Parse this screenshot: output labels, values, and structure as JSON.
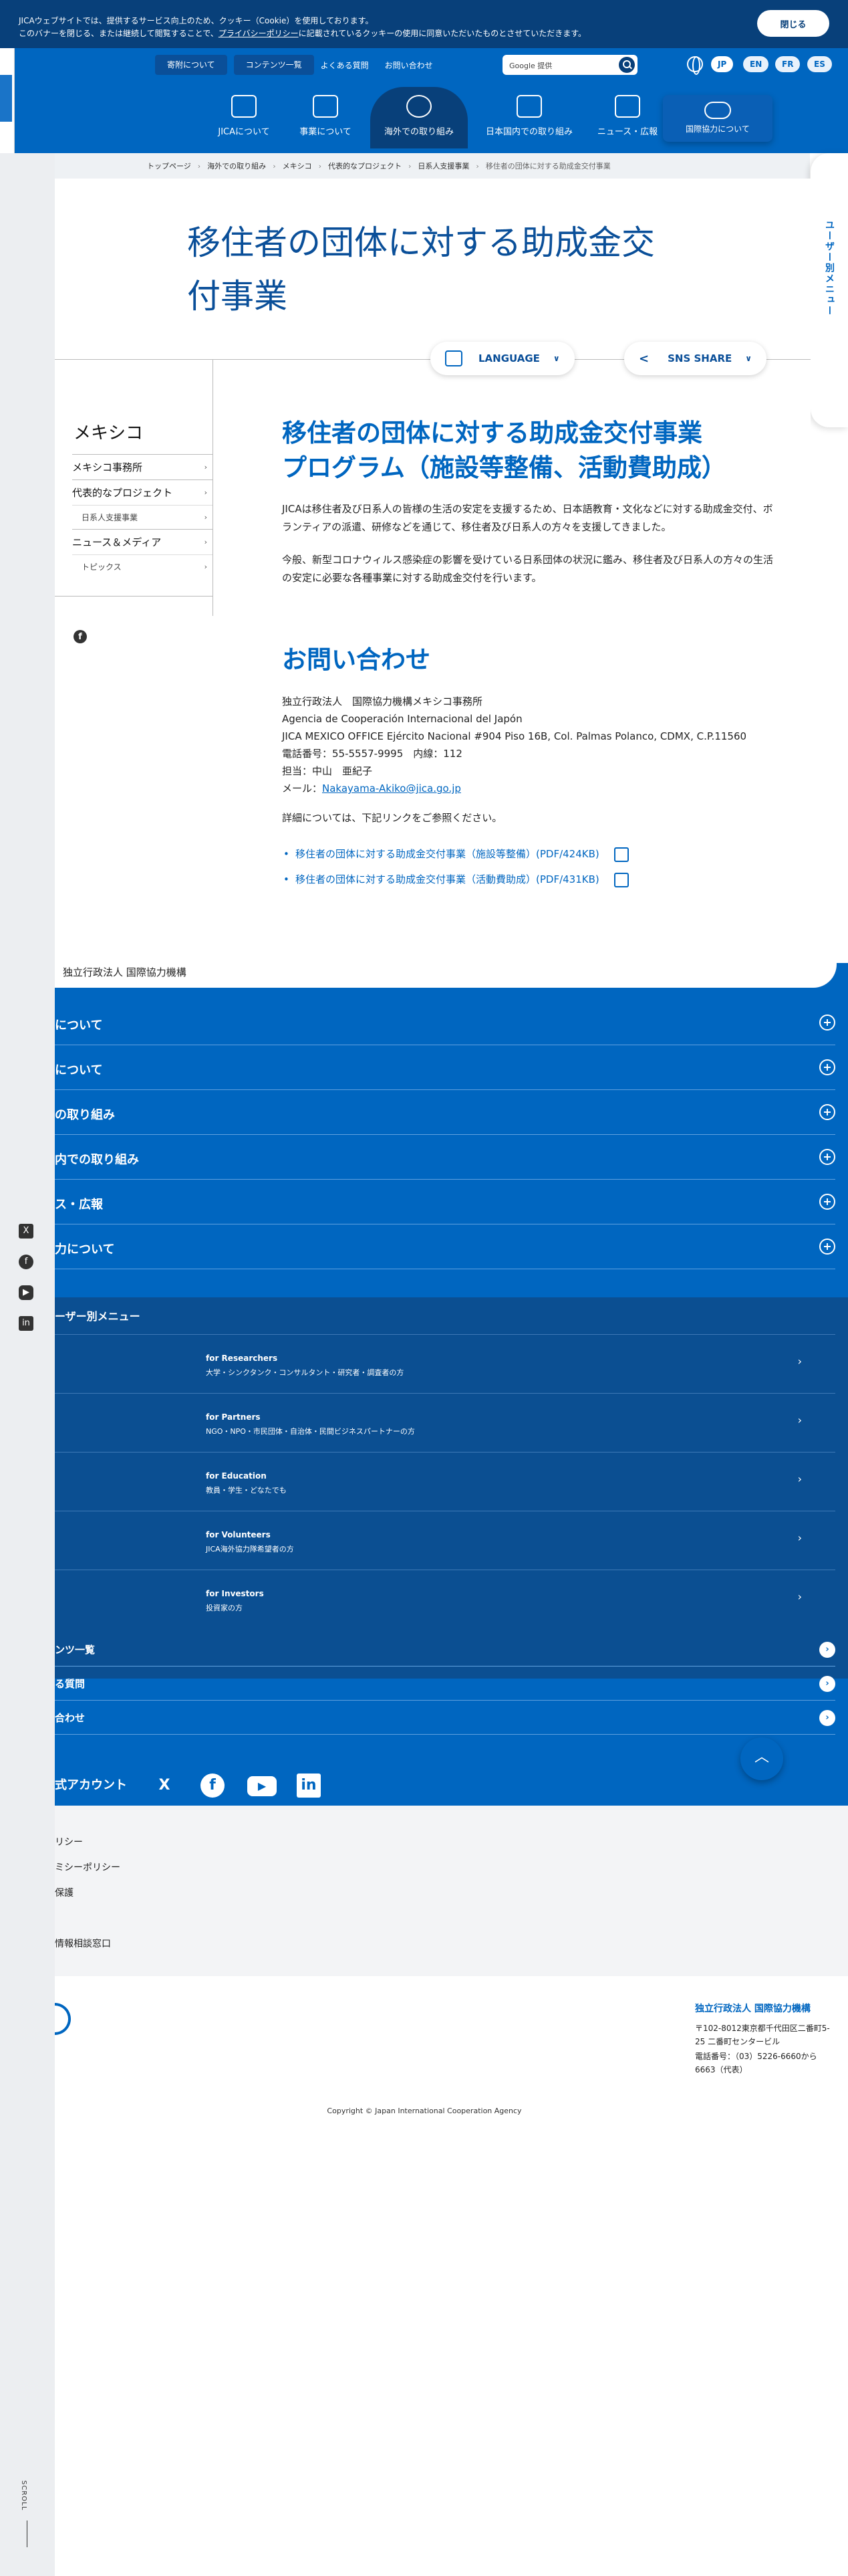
{
  "cookie": {
    "line1": "JICAウェブサイトでは、提供するサービス向上のため、クッキー（Cookie）を使用しております。",
    "line2_pre": "このバナーを閉じる、または継続して閲覧することで、",
    "line2_link": "プライバシーポリシー",
    "line2_post": "に記載されているクッキーの使用に同意いただいたものとさせていただきます。",
    "close_label": "閉じる"
  },
  "topnav": {
    "donate": "寄附について",
    "contents": "コンテンツ一覧",
    "faq": "よくある質問",
    "contact": "お問い合わせ",
    "search_placeholder": "Google 提供",
    "langs": [
      "JP",
      "EN",
      "FR",
      "ES"
    ]
  },
  "mainnav": {
    "items": [
      "JICAについて",
      "事業について",
      "海外での取り組み",
      "日本国内での取り組み",
      "ニュース・広報"
    ],
    "about": "国際協力について"
  },
  "breadcrumb": [
    "トップページ",
    "海外での取り組み",
    "メキシコ",
    "代表的なプロジェクト",
    "日系人支援事業",
    "移住者の団体に対する助成金交付事業"
  ],
  "usermenu": {
    "label": "ユーザー別メニュー"
  },
  "page": {
    "title_line1": "移住者の団体に対する助成金交",
    "title_line2": "付事業",
    "language_btn": "LANGUAGE",
    "sns_btn": "SNS SHARE"
  },
  "sidebar": {
    "heading": "メキシコ",
    "items": [
      {
        "label": "メキシコ事務所",
        "sub": false
      },
      {
        "label": "代表的なプロジェクト",
        "sub": false
      },
      {
        "label": "日系人支援事業",
        "sub": true
      },
      {
        "label": "ニュース＆メディア",
        "sub": false
      },
      {
        "label": "トピックス",
        "sub": true
      }
    ]
  },
  "content": {
    "heading_line1": "移住者の団体に対する助成金交付事業",
    "heading_line2": "プログラム（施設等整備、活動費助成）",
    "para1": "JICAは移住者及び日系人の皆様の生活の安定を支援するため、日本語教育・文化などに対する助成金交付、ボランティアの派遣、研修などを通じて、移住者及び日系人の方々を支援してきました。",
    "para2": "今般、新型コロナウィルス感染症の影響を受けている日系団体の状況に鑑み、移住者及び日系人の方々の生活の安定に必要な各種事業に対する助成金交付を行います。",
    "contact_heading": "お問い合わせ",
    "contact_lines": [
      "独立行政法人　国際協力機構メキシコ事務所",
      "Agencia de Cooperación Internacional del Japón",
      "JICA MEXICO OFFICE Ejército Nacional #904 Piso 16B, Col. Palmas Polanco, CDMX, C.P.11560",
      "電話番号：55-5557-9995　内線：112",
      "担当：中山　亜紀子"
    ],
    "mail_label": "メール：",
    "mail": "Nakayama-Akiko@jica.go.jp",
    "detail": "詳細については、下記リンクをご参照ください。",
    "links": [
      "移住者の団体に対する助成金交付事業（施設等整備）(PDF/424KB)",
      "移住者の団体に対する助成金交付事業（活動費助成）(PDF/431KB)"
    ]
  },
  "footer": {
    "org": "独立行政法人 国際協力機構",
    "menus": [
      "について",
      "について",
      "の取り組み",
      "内での取り組み",
      "ス・広報",
      "力について"
    ],
    "user_menu_title": "ーザー別メニュー",
    "user_rows": [
      {
        "en": "for Researchers",
        "ja": "大学・シンクタンク・コンサルタント・研究者・調査者の方"
      },
      {
        "en": "for Partners",
        "ja": "NGO・NPO・市民団体・自治体・民間ビジネスパートナーの方"
      },
      {
        "en": "for Education",
        "ja": "教員・学生・どなたでも"
      },
      {
        "en": "for Volunteers",
        "ja": "JICA海外協力隊希望者の方"
      },
      {
        "en": "for Investors",
        "ja": "投資家の方"
      }
    ],
    "link_rows": [
      "ンツ一覧",
      "る質問",
      "合わせ"
    ],
    "official": "式アカウント",
    "policies": [
      "リシー",
      "ミシーポリシー",
      "保護",
      "",
      "情報相談窓口"
    ],
    "addr_org": "独立行政法人 国際協力機構",
    "addr1": "〒102-8012東京都千代田区二番町5-25 二番町センタービル",
    "addr2": "電話番号：（03）5226-6660から6663（代表）",
    "copyright": "Copyright © Japan International Cooperation Agency"
  },
  "scroll_label": "SCROLL"
}
